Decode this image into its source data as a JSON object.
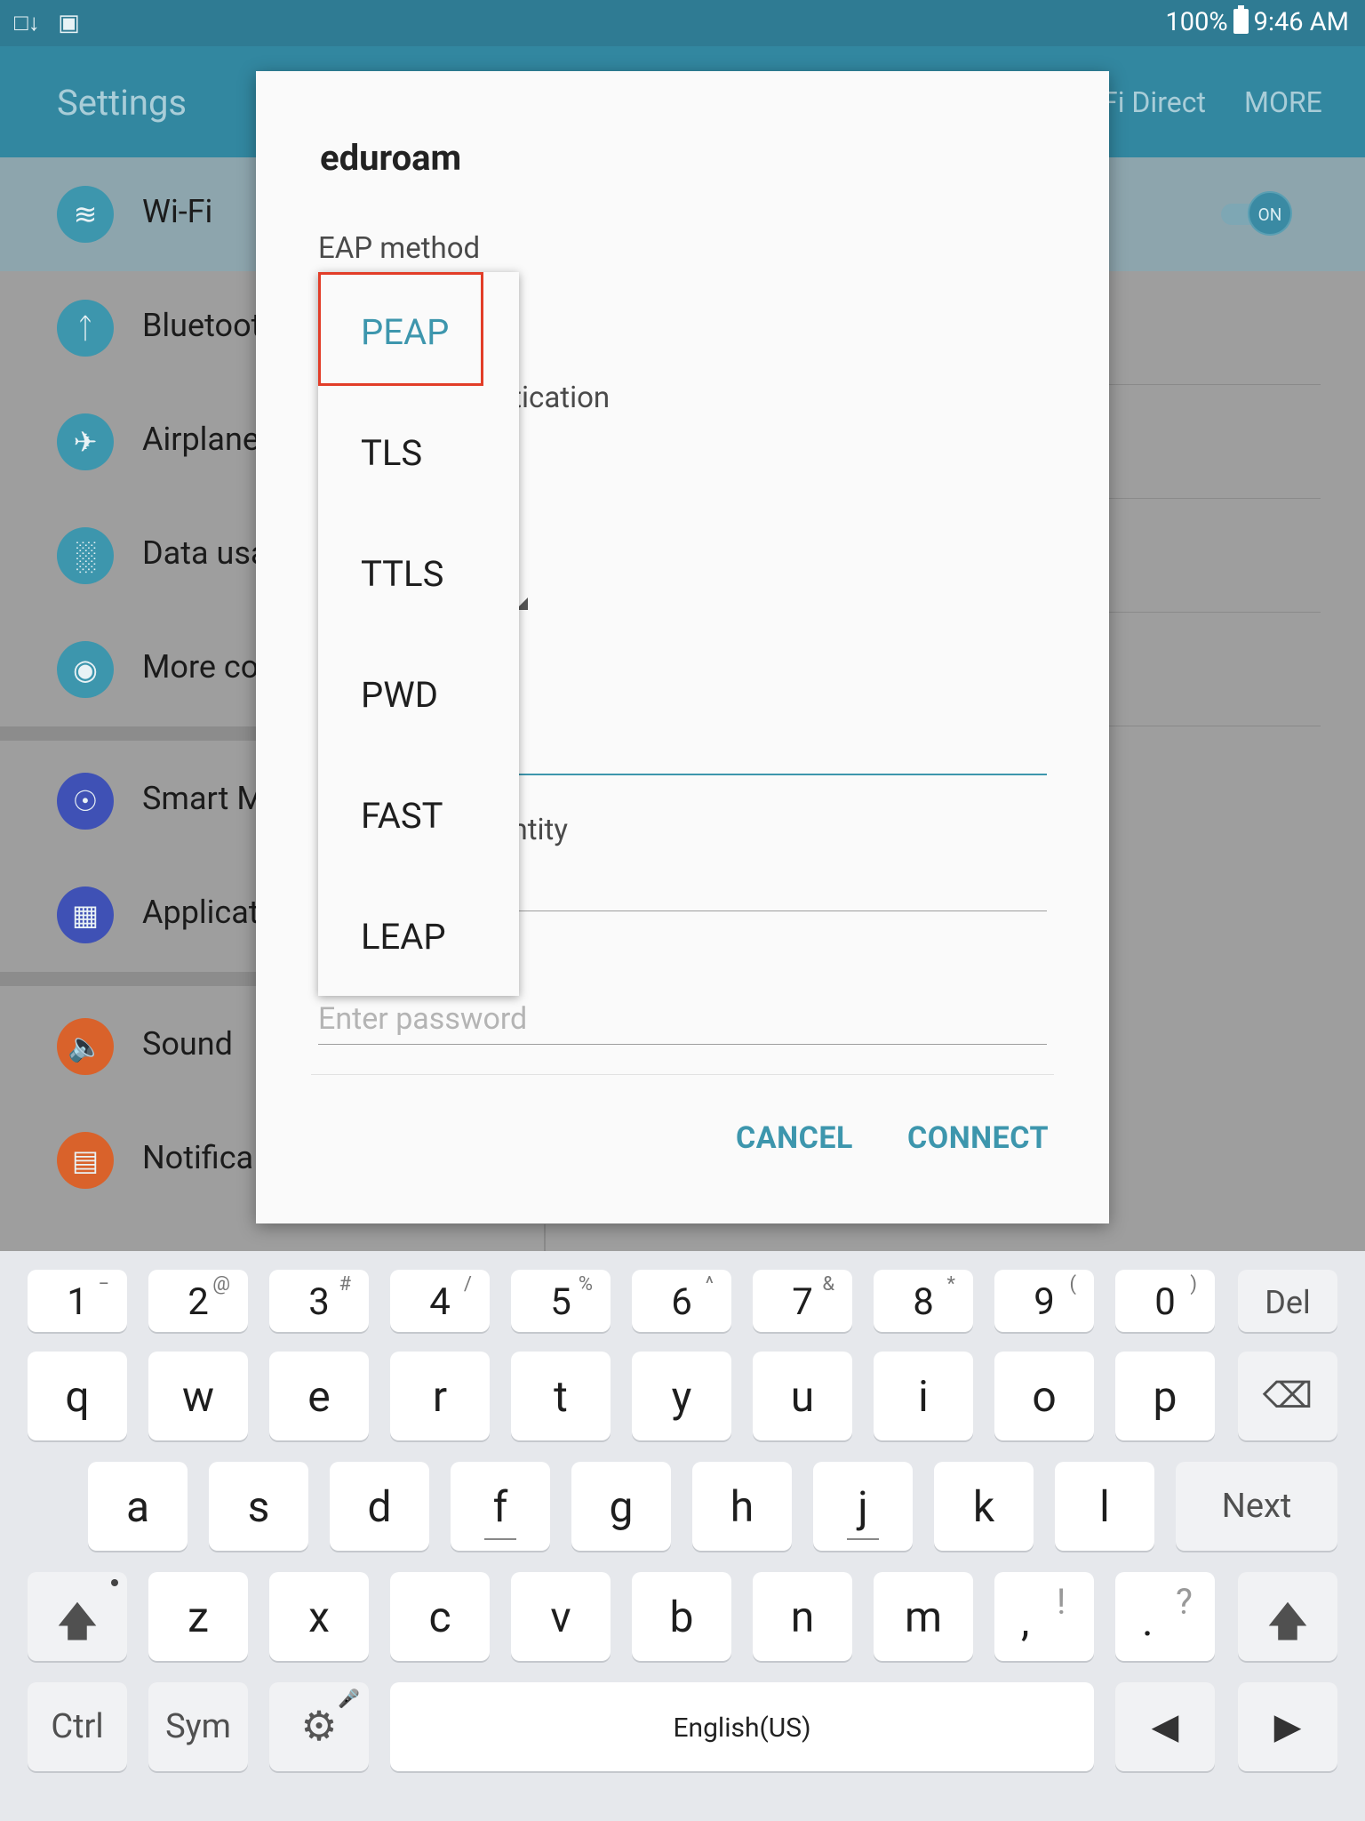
{
  "status_bar": {
    "left_icons": [
      "tablet-download-icon",
      "image-icon"
    ],
    "battery": "100%",
    "time": "9:46 AM"
  },
  "app_bar": {
    "title": "Settings",
    "wifi_direct": "Fi Direct",
    "more": "MORE"
  },
  "settings_items": [
    {
      "label": "Wi-Fi",
      "icon": "wifi-icon",
      "color": "#3d96ad"
    },
    {
      "label": "Bluetoot",
      "icon": "bluetooth-icon",
      "color": "#3d96ad"
    },
    {
      "label": "Airplane",
      "icon": "airplane-icon",
      "color": "#3d96ad"
    },
    {
      "label": "Data usa",
      "icon": "data-usage-icon",
      "color": "#3d96ad"
    },
    {
      "label": "More co",
      "icon": "more-connection-icon",
      "color": "#3d96ad"
    },
    {
      "label": "Smart M",
      "icon": "smart-manager-icon",
      "color": "#3f51b5"
    },
    {
      "label": "Applicat",
      "icon": "applications-icon",
      "color": "#3f51b5"
    },
    {
      "label": "Sound",
      "icon": "sound-icon",
      "color": "#d9622b"
    },
    {
      "label": "Notifica",
      "icon": "notifications-icon",
      "color": "#d9622b"
    }
  ],
  "wifi_toggle": "ON",
  "dialog": {
    "title": "eduroam",
    "eap_label": "EAP method",
    "phase2_label_fragment": "ntication",
    "identity_label_fragment": "entity",
    "password_placeholder": "Enter password",
    "cancel": "CANCEL",
    "connect": "CONNECT"
  },
  "eap_options": [
    "PEAP",
    "TLS",
    "TTLS",
    "PWD",
    "FAST",
    "LEAP"
  ],
  "eap_selected": "PEAP",
  "keyboard": {
    "num_row": [
      {
        "main": "1",
        "sub": "−"
      },
      {
        "main": "2",
        "sub": "@"
      },
      {
        "main": "3",
        "sub": "#"
      },
      {
        "main": "4",
        "sub": "/"
      },
      {
        "main": "5",
        "sub": "%"
      },
      {
        "main": "6",
        "sub": "^"
      },
      {
        "main": "7",
        "sub": "&"
      },
      {
        "main": "8",
        "sub": "*"
      },
      {
        "main": "9",
        "sub": "("
      },
      {
        "main": "0",
        "sub": ")"
      }
    ],
    "del": "Del",
    "row1": [
      "q",
      "w",
      "e",
      "r",
      "t",
      "y",
      "u",
      "i",
      "o",
      "p"
    ],
    "row2": [
      "a",
      "s",
      "d",
      "f",
      "g",
      "h",
      "j",
      "k",
      "l"
    ],
    "next": "Next",
    "row3": [
      {
        "main": "z"
      },
      {
        "main": "x"
      },
      {
        "main": "c"
      },
      {
        "main": "v"
      },
      {
        "main": "b"
      },
      {
        "main": "n"
      },
      {
        "main": "m"
      },
      {
        "main": ",",
        "sub": "!"
      },
      {
        "main": ".",
        "sub": "?"
      }
    ],
    "ctrl": "Ctrl",
    "sym": "Sym",
    "space": "English(US)"
  },
  "colors": {
    "accent": "#3d96ad",
    "highlight_box": "#e23d28",
    "action_bar": "#3287a0"
  }
}
